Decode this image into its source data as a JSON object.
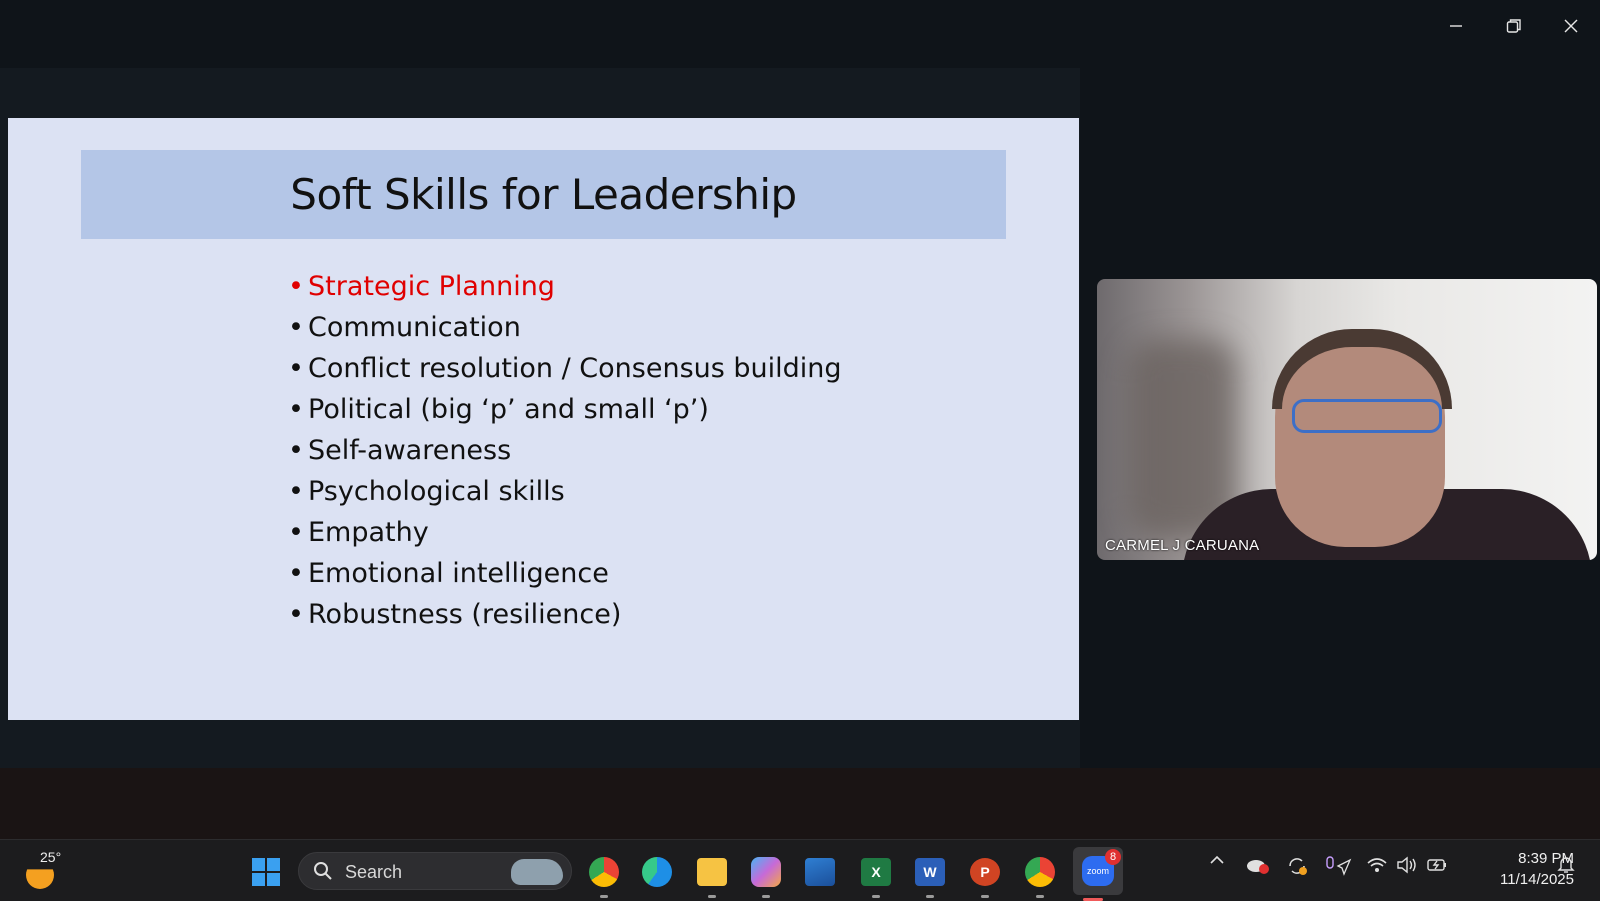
{
  "window": {
    "controls": {
      "minimize": "minimize-icon",
      "restore": "restore-icon",
      "close": "close-icon"
    }
  },
  "slide": {
    "title": "Soft Skills for Leadership",
    "title_bar_color": "#b4c6e7",
    "background_color": "#dce2f3",
    "highlight_color": "#e00000",
    "bullets": [
      {
        "text": "Strategic Planning",
        "highlighted": true
      },
      {
        "text": "Communication",
        "highlighted": false
      },
      {
        "text": "Conflict resolution / Consensus building",
        "highlighted": false
      },
      {
        "text": "Political (big ‘p’ and small ‘p’)",
        "highlighted": false
      },
      {
        "text": "Self-awareness",
        "highlighted": false
      },
      {
        "text": "Psychological skills",
        "highlighted": false
      },
      {
        "text": "Empathy",
        "highlighted": false
      },
      {
        "text": "Emotional intelligence",
        "highlighted": false
      },
      {
        "text": "Robustness (resilience)",
        "highlighted": false
      }
    ],
    "bullet_char": "•"
  },
  "video": {
    "participant_name": "CARMEL J CARUANA"
  },
  "taskbar": {
    "weather": {
      "temp": "25°",
      "icon": "weather-sun-icon"
    },
    "search": {
      "label": "Search",
      "icon": "search-icon"
    },
    "apps": [
      {
        "name": "chrome-profile",
        "icon": "chrome-icon"
      },
      {
        "name": "edge",
        "icon": "edge-icon"
      },
      {
        "name": "file-explorer",
        "icon": "folder-icon"
      },
      {
        "name": "copilot",
        "icon": "copilot-icon"
      },
      {
        "name": "photos",
        "icon": "photos-icon"
      },
      {
        "name": "excel",
        "icon": "excel-icon",
        "letter": "X"
      },
      {
        "name": "word",
        "icon": "word-icon",
        "letter": "W"
      },
      {
        "name": "powerpoint",
        "icon": "powerpoint-icon",
        "letter": "P"
      },
      {
        "name": "chrome",
        "icon": "chrome-icon"
      },
      {
        "name": "zoom",
        "icon": "zoom-icon",
        "label": "zoom",
        "badge": "8"
      }
    ],
    "tray": {
      "chevron": "^"
    },
    "clock": {
      "time": "8:39 PM",
      "date": "11/14/2025"
    }
  }
}
